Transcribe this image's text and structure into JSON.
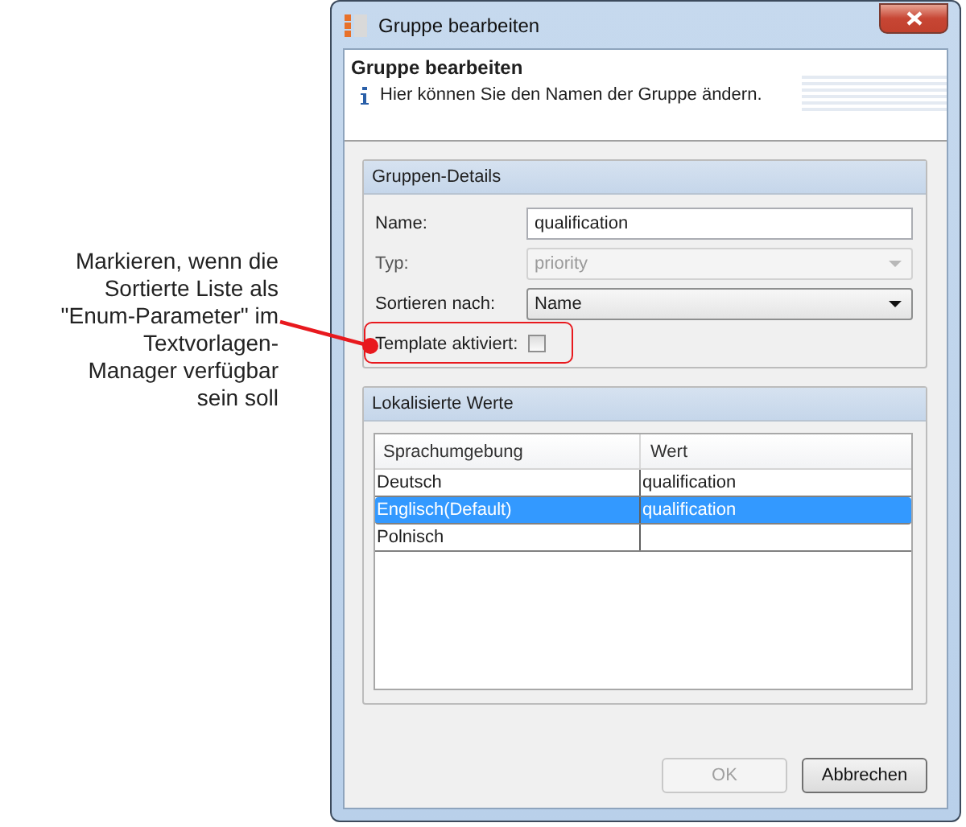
{
  "callout": {
    "lines": [
      "Markieren, wenn die",
      "Sortierte Liste als",
      "\"Enum-Parameter\" im",
      "Textvorlagen-",
      "Manager verfügbar",
      "sein soll"
    ]
  },
  "window": {
    "title": "Gruppe bearbeiten"
  },
  "header": {
    "title": "Gruppe bearbeiten",
    "info": "Hier können Sie den Namen der Gruppe ändern."
  },
  "details": {
    "title": "Gruppen-Details",
    "fields": [
      {
        "kind": "text",
        "label": "Name:",
        "value": "qualification",
        "disabled": false
      },
      {
        "kind": "select",
        "label": "Typ:",
        "value": "priority",
        "disabled": true
      },
      {
        "kind": "select",
        "label": "Sortieren nach:",
        "value": "Name",
        "disabled": false
      },
      {
        "kind": "checkbox",
        "label": "Template aktiviert:",
        "checked": false,
        "highlighted": true
      }
    ]
  },
  "localized": {
    "title": "Lokalisierte Werte",
    "columns": [
      "Sprachumgebung",
      "Wert"
    ],
    "rows": [
      {
        "cells": [
          "Deutsch",
          "qualification"
        ],
        "selected": false
      },
      {
        "cells": [
          "Englisch(Default)",
          "qualification"
        ],
        "selected": true
      },
      {
        "cells": [
          "Polnisch",
          ""
        ],
        "selected": false
      }
    ]
  },
  "buttons": [
    {
      "label": "OK",
      "disabled": true
    },
    {
      "label": "Abbrechen",
      "disabled": false
    }
  ]
}
